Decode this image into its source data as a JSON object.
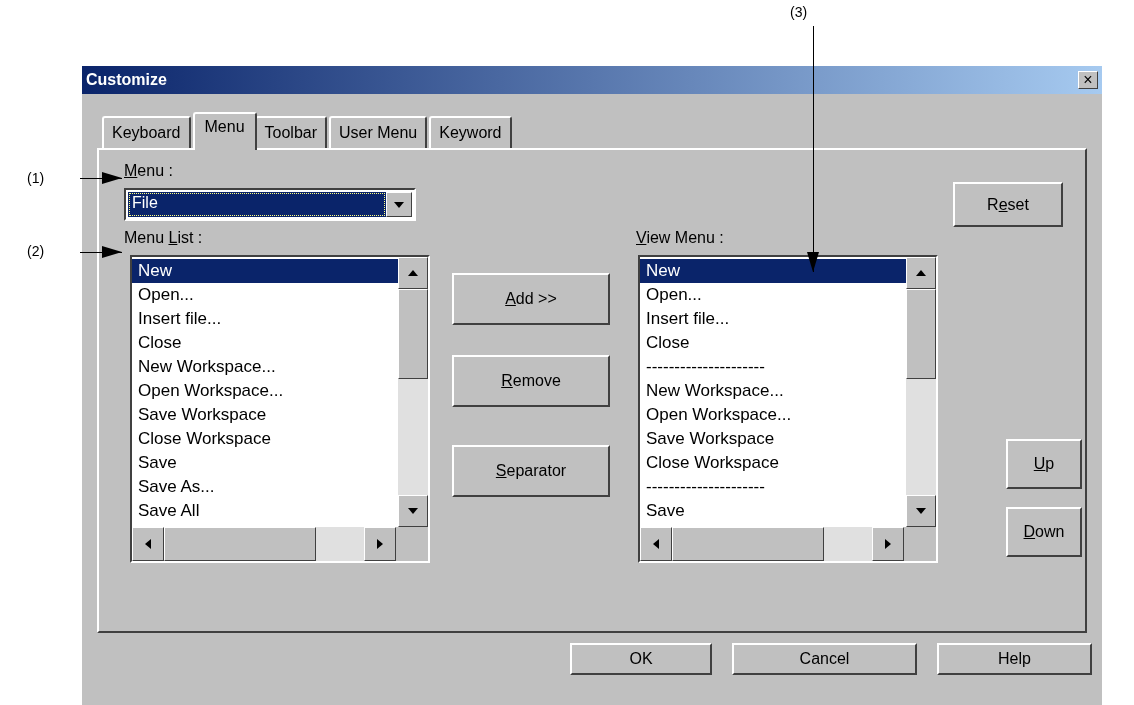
{
  "annotations": [
    {
      "label": "(1)"
    },
    {
      "label": "(2)"
    },
    {
      "label": "(3)"
    }
  ],
  "window": {
    "title": "Customize",
    "close": "×"
  },
  "tabs": [
    {
      "label": "Keyboard",
      "selected": false
    },
    {
      "label": "Menu",
      "selected": true
    },
    {
      "label": "Toolbar",
      "selected": false
    },
    {
      "label": "User Menu",
      "selected": false
    },
    {
      "label": "Keyword",
      "selected": false
    }
  ],
  "menu_label": {
    "key": "M",
    "rest": "enu :"
  },
  "menu_combo": {
    "value": "File",
    "focused": true
  },
  "reset_button": {
    "pre": "R",
    "key": "e",
    "rest": "set"
  },
  "menu_list_label": {
    "pre": "Menu ",
    "key": "L",
    "rest": "ist :"
  },
  "view_menu_label": {
    "key": "V",
    "rest": "iew Menu :"
  },
  "menu_list": [
    {
      "text": "New",
      "selected": true
    },
    {
      "text": "Open...",
      "selected": false
    },
    {
      "text": "Insert file...",
      "selected": false
    },
    {
      "text": "Close",
      "selected": false
    },
    {
      "text": "New Workspace...",
      "selected": false
    },
    {
      "text": "Open Workspace...",
      "selected": false
    },
    {
      "text": "Save Workspace",
      "selected": false
    },
    {
      "text": "Close Workspace",
      "selected": false
    },
    {
      "text": "Save",
      "selected": false
    },
    {
      "text": "Save As...",
      "selected": false
    },
    {
      "text": "Save All",
      "selected": false
    }
  ],
  "middle_buttons": [
    {
      "key": "A",
      "rest": "dd >>"
    },
    {
      "key": "R",
      "rest": "emove"
    },
    {
      "key": "S",
      "rest": "eparator"
    }
  ],
  "view_menu": [
    {
      "text": "New",
      "selected": true
    },
    {
      "text": "Open...",
      "selected": false
    },
    {
      "text": "Insert file...",
      "selected": false
    },
    {
      "text": "Close",
      "selected": false
    },
    {
      "text": "---------------------",
      "selected": false
    },
    {
      "text": "New Workspace...",
      "selected": false
    },
    {
      "text": "Open Workspace...",
      "selected": false
    },
    {
      "text": "Save Workspace",
      "selected": false
    },
    {
      "text": "Close Workspace",
      "selected": false
    },
    {
      "text": "---------------------",
      "selected": false
    },
    {
      "text": "Save",
      "selected": false
    }
  ],
  "order_buttons": [
    {
      "key": "U",
      "rest": "p"
    },
    {
      "key": "D",
      "rest": "own"
    }
  ],
  "footer_buttons": [
    "OK",
    "Cancel",
    "Help"
  ]
}
